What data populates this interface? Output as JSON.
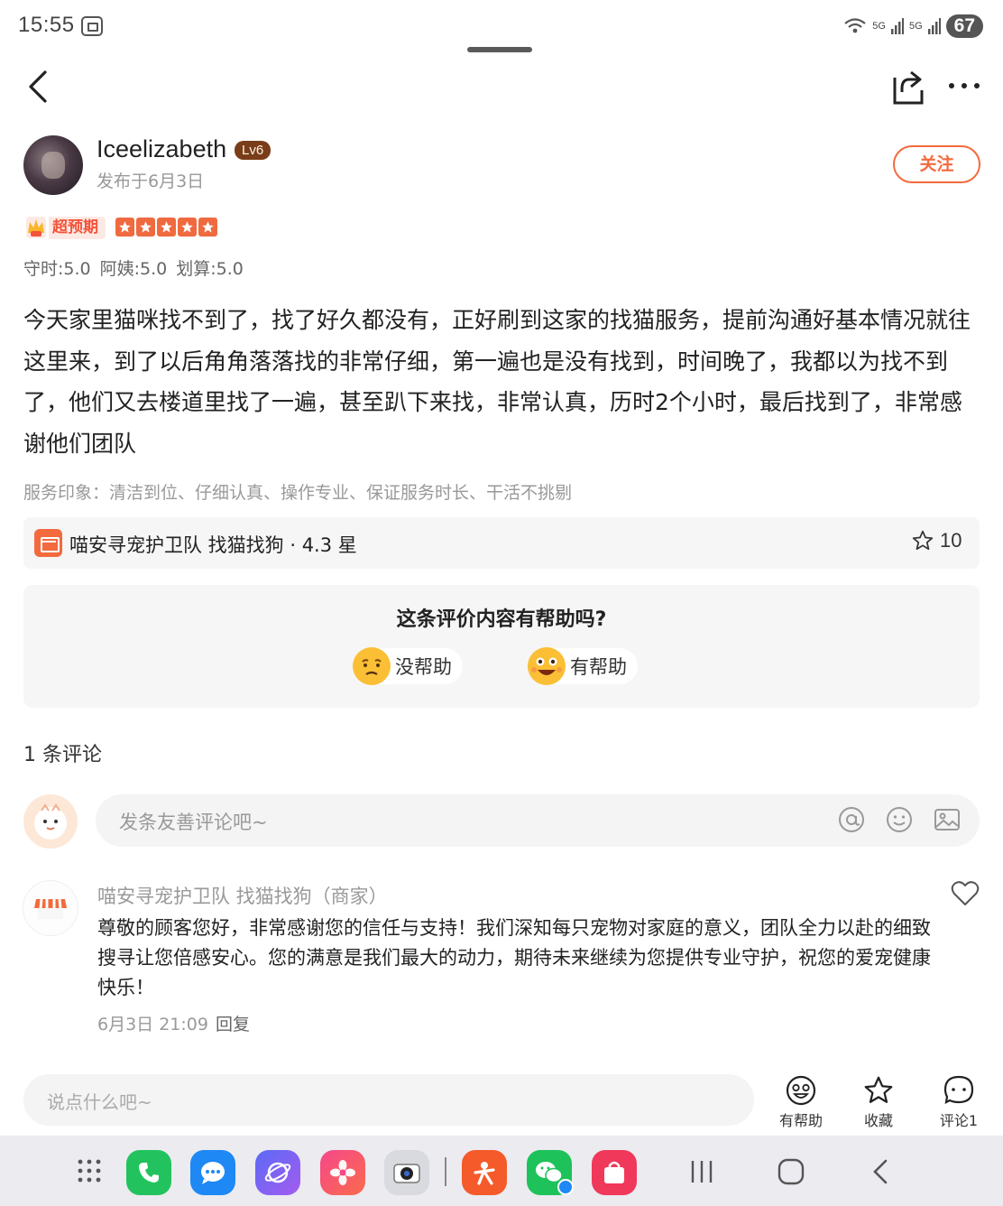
{
  "status_bar": {
    "time": "15:55",
    "network_1": "5G",
    "network_2": "5G",
    "battery": "67"
  },
  "author": {
    "name": "Iceelizabeth",
    "level": "Lv6",
    "date": "发布于6月3日",
    "follow_label": "关注"
  },
  "rating": {
    "badge": "超预期",
    "stars": 5,
    "scores": [
      "守时:5.0",
      "阿姨:5.0",
      "划算:5.0"
    ]
  },
  "review": {
    "text": "今天家里猫咪找不到了，找了好久都没有，正好刷到这家的找猫服务，提前沟通好基本情况就往这里来，到了以后角角落落找的非常仔细，第一遍也是没有找到，时间晚了，我都以为找不到了，他们又去楼道里找了一遍，甚至趴下来找，非常认真，历时2个小时，最后找到了，非常感谢他们团队",
    "impression": "服务印象：清洁到位、仔细认真、操作专业、保证服务时长、干活不挑剔"
  },
  "shop": {
    "name": "喵安寻宠护卫队 找猫找狗 · 4.3 星",
    "fav_count": "10"
  },
  "helpful": {
    "question": "这条评价内容有帮助吗?",
    "no_label": "没帮助",
    "yes_label": "有帮助"
  },
  "comments": {
    "count_label": "1 条评论",
    "input_placeholder": "发条友善评论吧~",
    "items": [
      {
        "name": "喵安寻宠护卫队 找猫找狗（商家）",
        "text": "尊敬的顾客您好，非常感谢您的信任与支持！我们深知每只宠物对家庭的意义，团队全力以赴的细致搜寻让您倍感安心。您的满意是我们最大的动力，期待未来继续为您提供专业守护，祝您的爱宠健康快乐！",
        "date": "6月3日 21:09",
        "reply_label": "回复"
      }
    ]
  },
  "bottom_bar": {
    "say_placeholder": "说点什么吧~",
    "helpful_label": "有帮助",
    "collect_label": "收藏",
    "comment_label": "评论1"
  },
  "dock": {
    "apps": [
      "apps-grid-icon",
      "phone-icon",
      "messages-icon",
      "browser-icon",
      "gallery-icon",
      "camera-icon",
      "dianping-icon",
      "wechat-icon",
      "store-icon"
    ]
  },
  "colors": {
    "accent": "#f36a3e",
    "badge_text": "#f4543a",
    "card_bg": "#f6f6f6"
  }
}
